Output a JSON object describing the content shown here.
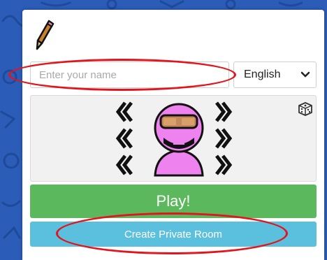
{
  "name_input": {
    "placeholder": "Enter your name",
    "value": ""
  },
  "language_select": {
    "selected": "English"
  },
  "avatar_panel": {
    "arrow_left_icon": "chevron-left-icon",
    "arrow_right_icon": "chevron-right-icon",
    "randomize_icon": "dice-icon",
    "avatar_color": "#ee82ee"
  },
  "buttons": {
    "play_label": "Play!",
    "private_room_label": "Create Private Room"
  },
  "colors": {
    "background": "#2b5cb8",
    "play": "#5cb85c",
    "private_room": "#5bc0de",
    "annotation": "#e3141b"
  }
}
